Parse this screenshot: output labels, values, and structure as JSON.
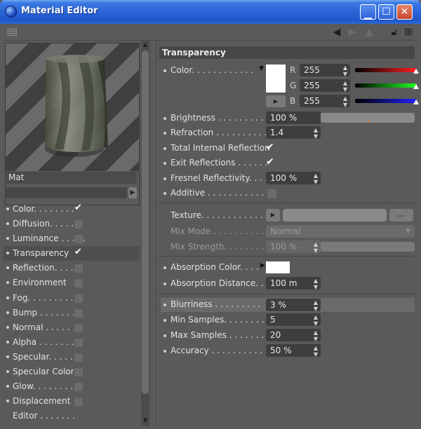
{
  "window": {
    "title": "Material Editor",
    "controls": [
      "minimize",
      "maximize",
      "close"
    ]
  },
  "toolbar": {
    "icons": [
      "grip-icon",
      "arrow-left-icon",
      "arrow-right-icon",
      "triangle-up-icon",
      "lock-icon",
      "new-window-icon"
    ]
  },
  "preview": {
    "material_name": "Mat"
  },
  "channels": [
    {
      "label": "Color. . . . . . . .",
      "checked": true,
      "selected": false
    },
    {
      "label": "Diffusion. . . . . .",
      "checked": false,
      "selected": false
    },
    {
      "label": "Luminance . . . . .",
      "checked": false,
      "selected": false
    },
    {
      "label": "Transparency",
      "checked": true,
      "selected": true
    },
    {
      "label": "Reflection. . . . .",
      "checked": false,
      "selected": false
    },
    {
      "label": "Environment",
      "checked": false,
      "selected": false
    },
    {
      "label": "Fog. . . . . . . . .",
      "checked": false,
      "selected": false
    },
    {
      "label": "Bump . . . . . . . .",
      "checked": false,
      "selected": false
    },
    {
      "label": "Normal . . . . . . .",
      "checked": false,
      "selected": false
    },
    {
      "label": "Alpha . . . . . . . .",
      "checked": false,
      "selected": false
    },
    {
      "label": "Specular. . . . . .",
      "checked": false,
      "selected": false
    },
    {
      "label": "Specular Color",
      "checked": false,
      "selected": false
    },
    {
      "label": "Glow. . . . . . . . .",
      "checked": false,
      "selected": false
    },
    {
      "label": "Displacement",
      "checked": false,
      "selected": false
    },
    {
      "label": "Editor . . . . . . .",
      "checked": null,
      "selected": false
    }
  ],
  "transparency": {
    "section_title": "Transparency",
    "color_label": "Color. . . . . . . . . . . .",
    "swatch_color": "#ffffff",
    "r": {
      "letter": "R",
      "value": "255",
      "color": "#ff2020"
    },
    "g": {
      "letter": "G",
      "value": "255",
      "color": "#20ff20"
    },
    "b": {
      "letter": "B",
      "value": "255",
      "color": "#2020ff"
    },
    "brightness_label": "Brightness . . . . . . . . .",
    "brightness_value": "100 %",
    "brightness_level": 1.0,
    "refraction_label": "Refraction . . . . . . . . . .",
    "refraction_value": "1.4",
    "total_internal_label": "Total Internal Reflection",
    "total_internal_checked": true,
    "exit_reflections_label": "Exit Reflections . . . . . .",
    "exit_reflections_checked": true,
    "fresnel_label": "Fresnel Reflectivity. . . .",
    "fresnel_value": "100 %",
    "additive_label": "Additive . . . . . . . . . . .",
    "additive_checked": false,
    "texture_label": "Texture. . . . . . . . . . . .",
    "texture_more": "...",
    "mix_mode_label": "Mix Mode . . . . . . . . . .",
    "mix_mode_value": "Normal",
    "mix_strength_label": "Mix Strength. . . . . . . .",
    "mix_strength_value": "100 %",
    "absorption_color_label": "Absorption Color. . . .",
    "absorption_color": "#ffffff",
    "absorption_distance_label": "Absorption Distance. . . .",
    "absorption_distance_value": "100 m",
    "blurriness_label": "Blurriness . . . . . . . . .",
    "blurriness_value": "3 %",
    "min_samples_label": "Min Samples. . . . . . . .",
    "min_samples_value": "5",
    "max_samples_label": "Max Samples . . . . . . . .",
    "max_samples_value": "20",
    "accuracy_label": "Accuracy . . . . . . . . . .",
    "accuracy_value": "50 %"
  }
}
